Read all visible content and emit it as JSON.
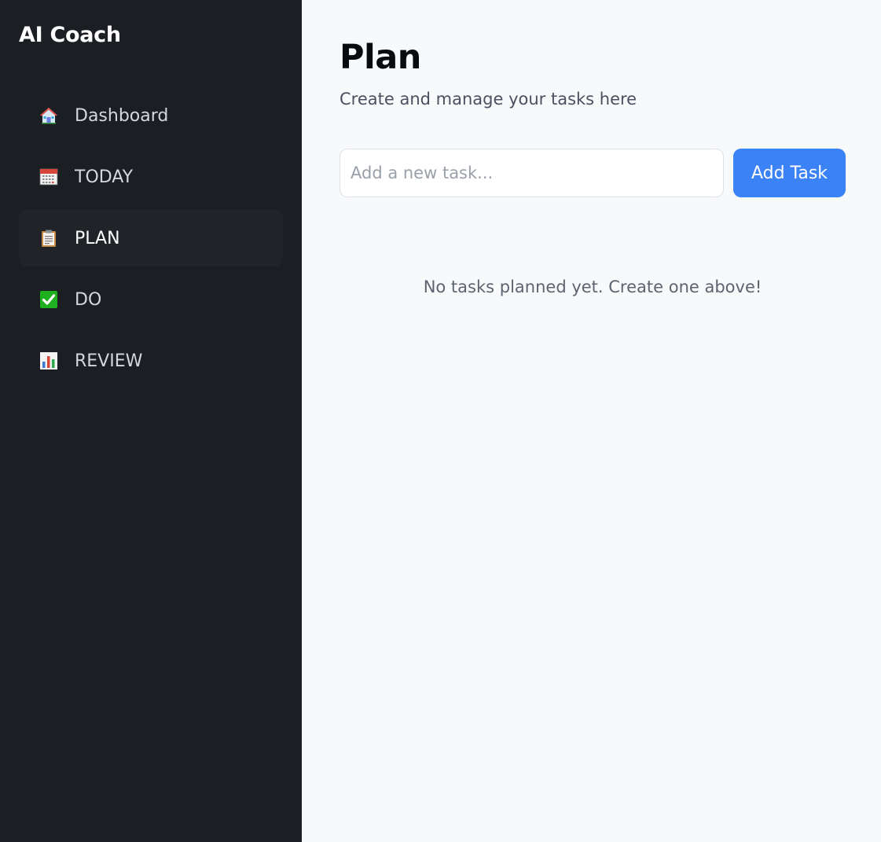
{
  "app": {
    "title": "AI Coach"
  },
  "sidebar": {
    "items": [
      {
        "label": "Dashboard",
        "icon": "house-icon",
        "active": false
      },
      {
        "label": "TODAY",
        "icon": "calendar-icon",
        "active": false
      },
      {
        "label": "PLAN",
        "icon": "clipboard-icon",
        "active": true
      },
      {
        "label": "DO",
        "icon": "check-box-icon",
        "active": false
      },
      {
        "label": "REVIEW",
        "icon": "bar-chart-icon",
        "active": false
      }
    ]
  },
  "main": {
    "title": "Plan",
    "subtitle": "Create and manage your tasks here",
    "task_input": {
      "placeholder": "Add a new task...",
      "value": ""
    },
    "add_button_label": "Add Task",
    "empty_message": "No tasks planned yet. Create one above!"
  },
  "colors": {
    "sidebar_bg": "#1b1e23",
    "main_bg": "#f8f9fb",
    "accent": "#3b82f6"
  }
}
